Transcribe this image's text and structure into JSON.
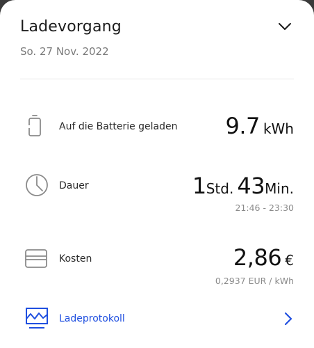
{
  "header": {
    "title": "Ladevorgang",
    "date": "So. 27 Nov. 2022"
  },
  "rows": {
    "battery": {
      "label": "Auf die Batterie geladen",
      "value": "9.7",
      "unit": "kWh",
      "icon": "battery-icon"
    },
    "duration": {
      "label": "Dauer",
      "hours": "1",
      "hours_unit": "Std.",
      "minutes": "43",
      "minutes_unit": "Min.",
      "time_range": "21:46 - 23:30",
      "icon": "clock-icon"
    },
    "cost": {
      "label": "Kosten",
      "value": "2,86",
      "currency": "€",
      "rate": "0,2937 EUR / kWh",
      "icon": "card-icon"
    }
  },
  "protocol": {
    "label": "Ladeprotokoll",
    "icon": "chart-icon"
  },
  "colors": {
    "accent": "#1f4fe0",
    "icon_gray": "#8a8a8a",
    "background": "#ffffff"
  }
}
